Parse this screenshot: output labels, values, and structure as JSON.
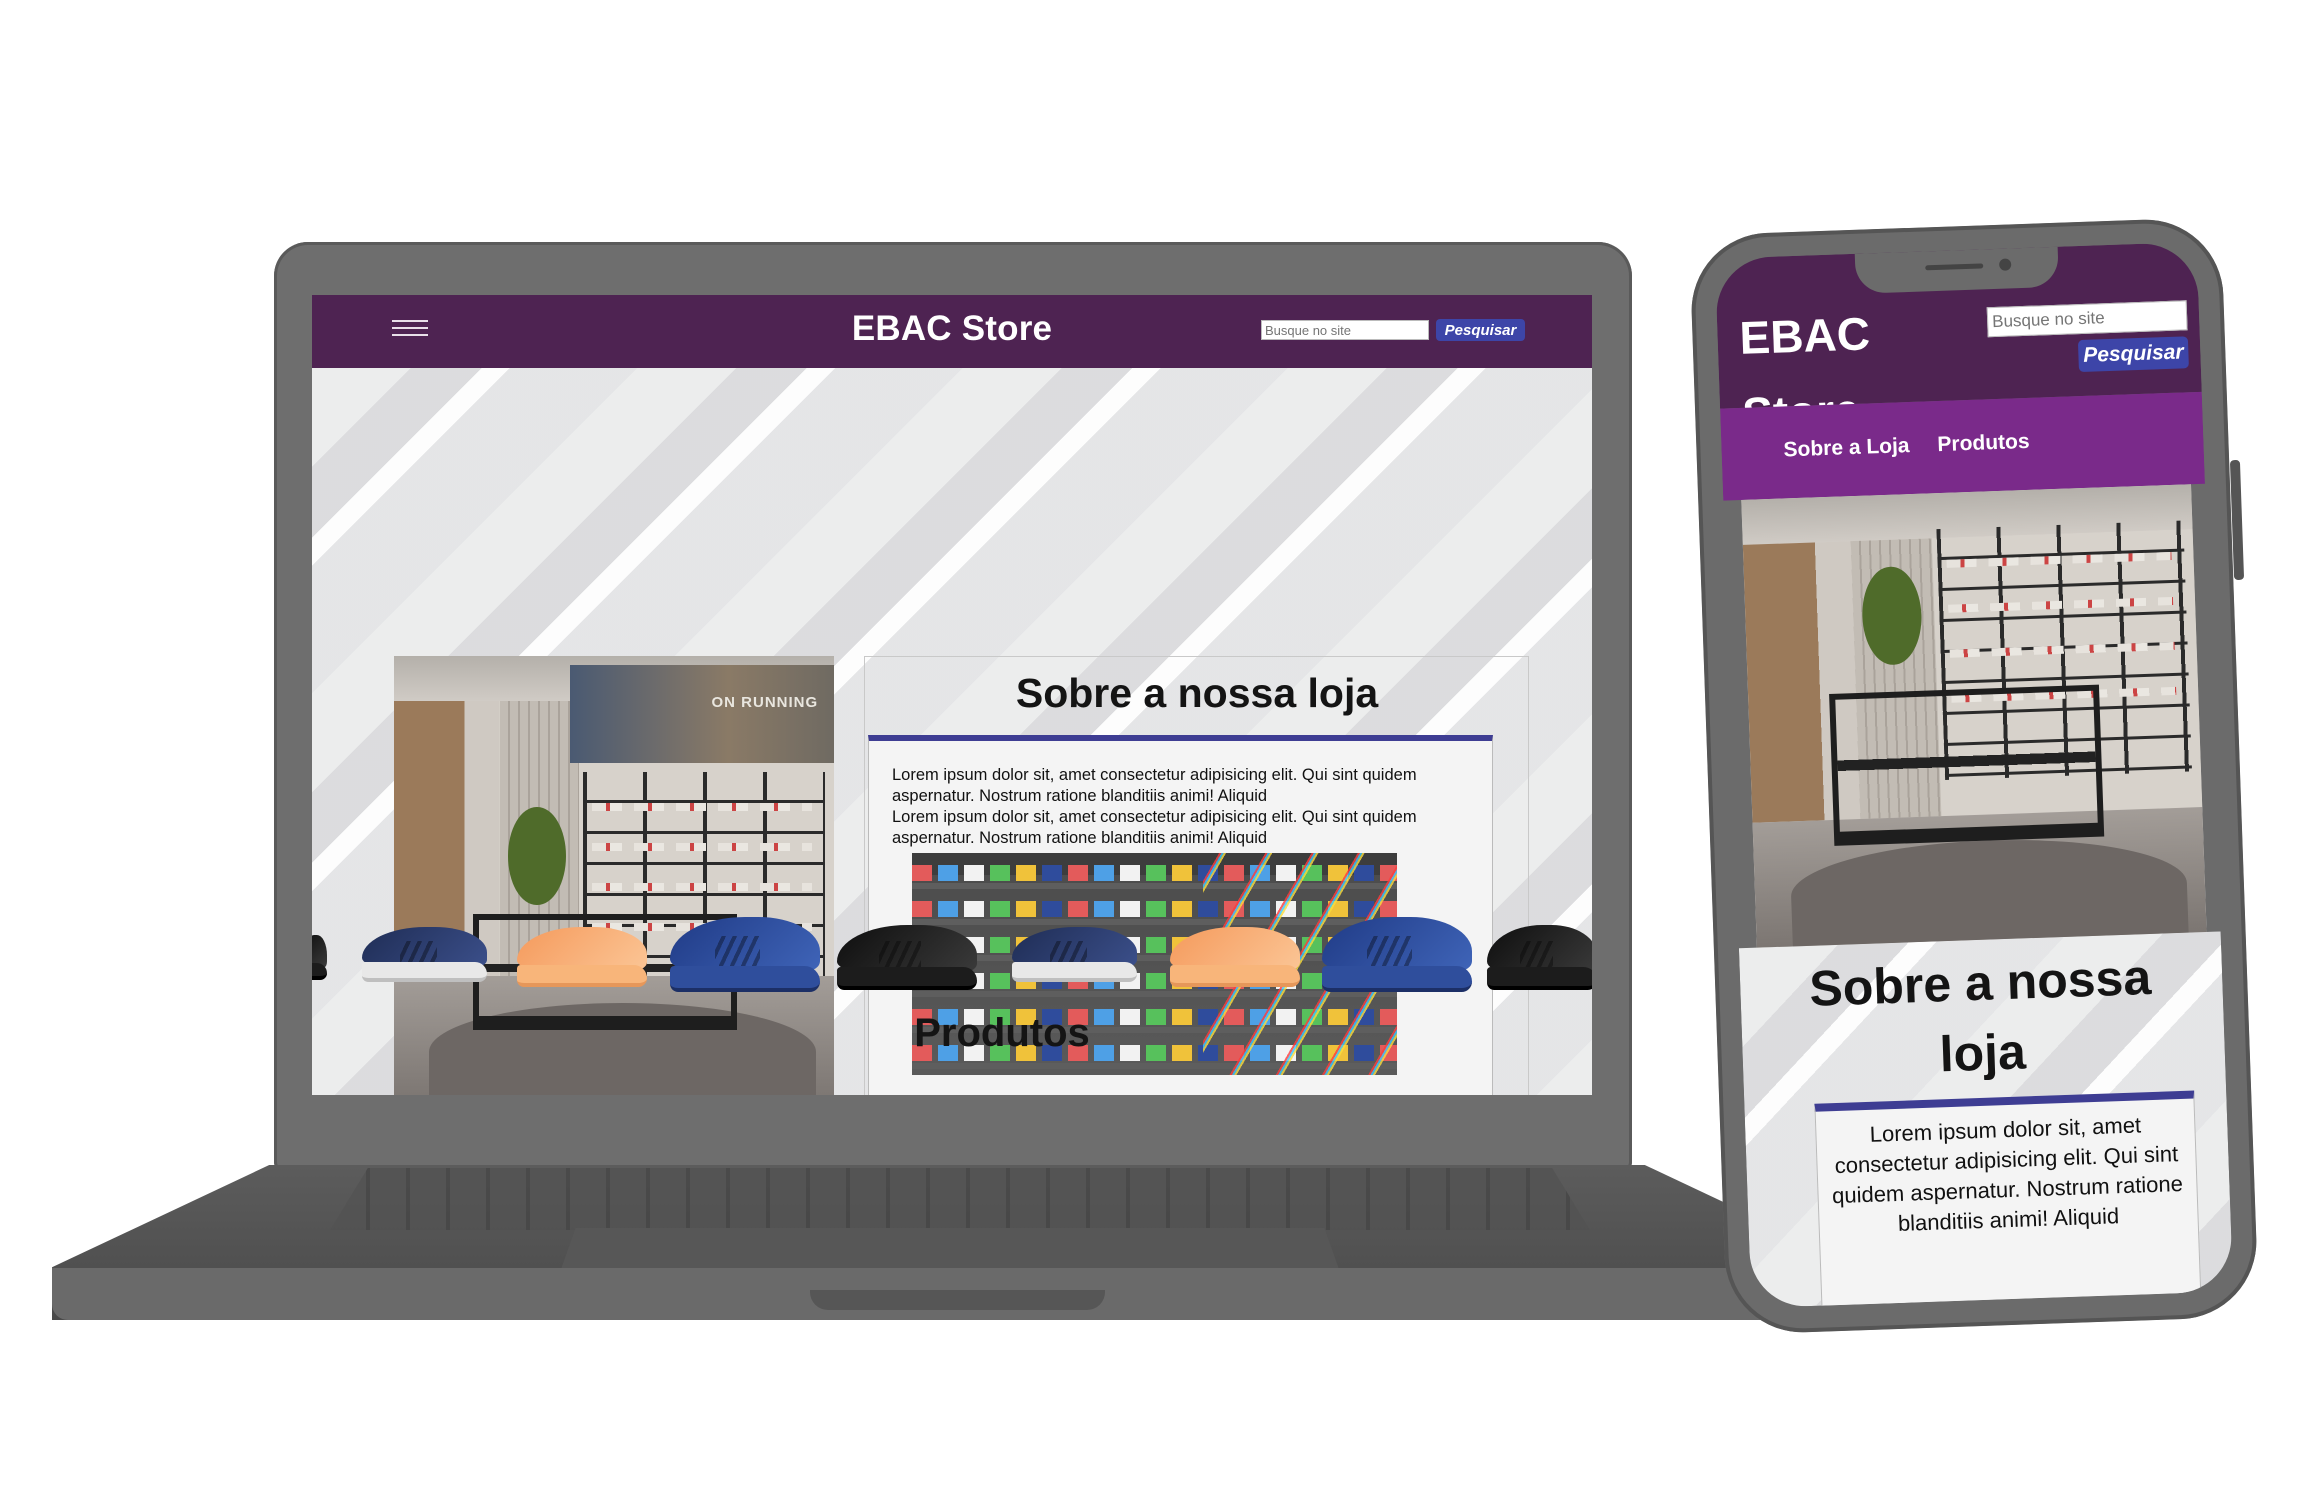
{
  "site": {
    "brand": "EBAC Store",
    "search_placeholder": "Busque no site",
    "search_button": "Pesquisar"
  },
  "about": {
    "heading": "Sobre a nossa loja",
    "paragraph_1": "Lorem ipsum dolor sit, amet consectetur adipisicing elit. Qui sint quidem aspernatur. Nostrum ratione blanditiis animi! Aliquid",
    "paragraph_2": "Lorem ipsum dolor sit, amet consectetur adipisicing elit. Qui sint quidem aspernatur. Nostrum ratione blanditiis animi! Aliquid"
  },
  "store_banner": "ON RUNNING",
  "products": {
    "heading": "Produtos",
    "carousel": [
      {
        "colorway": "navy"
      },
      {
        "colorway": "peach"
      },
      {
        "colorway": "royal-blue"
      },
      {
        "colorway": "black"
      },
      {
        "colorway": "navy"
      },
      {
        "colorway": "peach"
      },
      {
        "colorway": "royal-blue"
      },
      {
        "colorway": "black"
      }
    ]
  },
  "mobile": {
    "nav": [
      "Sobre a Loja",
      "Produtos"
    ],
    "about_paragraph": "Lorem ipsum dolor sit, amet consectetur adipisicing elit. Qui sint quidem aspernatur. Nostrum ratione blanditiis animi! Aliquid"
  },
  "colors": {
    "header": "#4e2352",
    "nav": "#7a2a8a",
    "button": "#3d45a8",
    "accent_line": "#3e3d93"
  }
}
